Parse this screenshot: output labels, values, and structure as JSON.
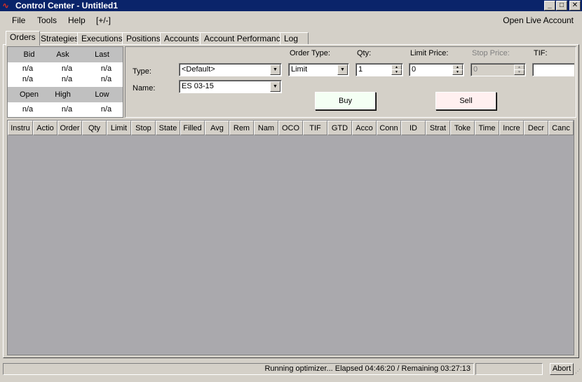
{
  "window": {
    "title": "Control Center - Untitled1",
    "app_icon": "ninja-logo-icon",
    "buttons": {
      "minimize": "_",
      "maximize": "□",
      "close": "✕"
    }
  },
  "menu": {
    "items": [
      "File",
      "Tools",
      "Help",
      "[+/-]"
    ],
    "right_link": "Open Live Account"
  },
  "tabs": [
    "Orders",
    "Strategies",
    "Executions",
    "Positions",
    "Accounts",
    "Account Performance",
    "Log"
  ],
  "quote": {
    "row1_headers": [
      "Bid",
      "Ask",
      "Last"
    ],
    "row1_values_a": [
      "n/a",
      "n/a",
      "n/a"
    ],
    "row1_values_b": [
      "n/a",
      "n/a",
      "n/a"
    ],
    "row2_headers": [
      "Open",
      "High",
      "Low"
    ],
    "row2_values": [
      "n/a",
      "n/a",
      "n/a"
    ]
  },
  "order_entry": {
    "type_label": "Type:",
    "type_value": "<Default>",
    "name_label": "Name:",
    "name_value": "ES 03-15",
    "order_type_label": "Order Type:",
    "order_type_value": "Limit",
    "qty_label": "Qty:",
    "qty_value": "1",
    "limit_price_label": "Limit Price:",
    "limit_price_value": "0",
    "stop_price_label": "Stop Price:",
    "stop_price_value": "0",
    "tif_label": "TIF:",
    "tif_value": "",
    "buy_label": "Buy",
    "sell_label": "Sell",
    "buy_color": "#f4fff4",
    "sell_color": "#fff0f0"
  },
  "grid": {
    "columns": [
      "Instru",
      "Actio",
      "Order",
      "Qty",
      "Limit",
      "Stop",
      "State",
      "Filled",
      "Avg",
      "Rem",
      "Nam",
      "OCO",
      "TIF",
      "GTD",
      "Acco",
      "Conn",
      "ID",
      "Strat",
      "Toke",
      "Time",
      "Incre",
      "Decr",
      "Canc"
    ],
    "rows": []
  },
  "status": {
    "message": "Running optimizer... Elapsed 04:46:20 / Remaining 03:27:13",
    "abort_label": "Abort"
  }
}
